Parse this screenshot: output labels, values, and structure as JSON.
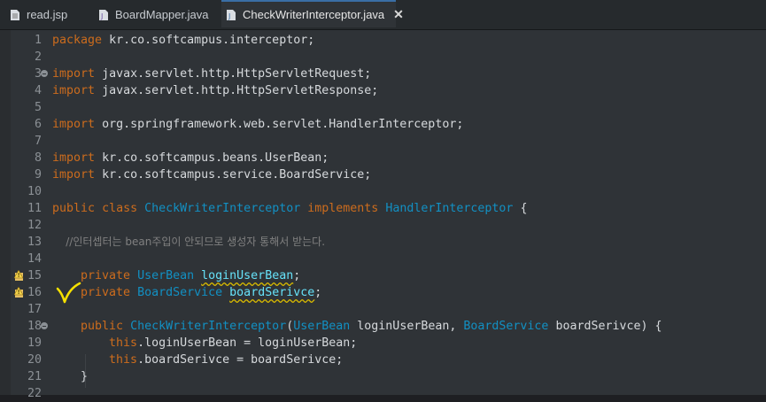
{
  "tabs": [
    {
      "label": "read.jsp",
      "active": false
    },
    {
      "label": "BoardMapper.java",
      "active": false
    },
    {
      "label": "CheckWriterInterceptor.java",
      "active": true
    }
  ],
  "colors": {
    "keyword": "#cc6c1d",
    "type": "#1290c3",
    "field": "#66e1f8",
    "comment": "#808080",
    "annotation_mark": "#f5e000"
  },
  "editor": {
    "lines": [
      {
        "n": "1",
        "segs": [
          [
            "kw",
            "package"
          ],
          [
            "",
            "kr.co.softcampus.interceptor;"
          ]
        ]
      },
      {
        "n": "2",
        "segs": []
      },
      {
        "n": "3",
        "fold": true,
        "segs": [
          [
            "kw",
            "import"
          ],
          [
            "",
            "javax.servlet.http.HttpServletRequest;"
          ]
        ]
      },
      {
        "n": "4",
        "segs": [
          [
            "kw",
            "import"
          ],
          [
            "",
            "javax.servlet.http.HttpServletResponse;"
          ]
        ]
      },
      {
        "n": "5",
        "segs": []
      },
      {
        "n": "6",
        "segs": [
          [
            "kw",
            "import"
          ],
          [
            "",
            "org.springframework.web.servlet.HandlerInterceptor;"
          ]
        ]
      },
      {
        "n": "7",
        "segs": []
      },
      {
        "n": "8",
        "segs": [
          [
            "kw",
            "import"
          ],
          [
            "",
            "kr.co.softcampus.beans.UserBean;"
          ]
        ]
      },
      {
        "n": "9",
        "segs": [
          [
            "kw",
            "import"
          ],
          [
            "",
            "kr.co.softcampus.service.BoardService;"
          ]
        ]
      },
      {
        "n": "10",
        "segs": []
      },
      {
        "n": "11",
        "segs": [
          [
            "kw",
            "public"
          ],
          [
            "kw",
            "class"
          ],
          [
            "ty",
            "CheckWriterInterceptor"
          ],
          [
            "kw",
            "implements"
          ],
          [
            "ty",
            "HandlerInterceptor"
          ],
          [
            "",
            "{"
          ]
        ]
      },
      {
        "n": "12",
        "segs": []
      },
      {
        "n": "13",
        "segs": [
          [
            "cm",
            "    //인터셉터는 bean주입이 안되므로 생성자 통해서 받는다."
          ]
        ]
      },
      {
        "n": "14",
        "segs": []
      },
      {
        "n": "15",
        "warn": true,
        "segs": [
          [
            "kw",
            "    private"
          ],
          [
            "ty",
            "UserBean"
          ],
          [
            "fld squig",
            "loginUserBean"
          ],
          [
            "",
            ";"
          ]
        ]
      },
      {
        "n": "16",
        "warn": true,
        "segs": [
          [
            "kw",
            "    private"
          ],
          [
            "ty",
            "BoardService"
          ],
          [
            "fld squig",
            "boardSerivce"
          ],
          [
            "",
            ";"
          ]
        ]
      },
      {
        "n": "17",
        "segs": []
      },
      {
        "n": "18",
        "fold": true,
        "segs": [
          [
            "kw",
            "    public"
          ],
          [
            "ty",
            "CheckWriterInterceptor"
          ],
          [
            "",
            "("
          ],
          [
            "ty",
            "UserBean"
          ],
          [
            "",
            "loginUserBean,"
          ],
          [
            "ty",
            "BoardService"
          ],
          [
            "",
            "boardSerivce) {"
          ]
        ]
      },
      {
        "n": "19",
        "segs": [
          [
            "kw",
            "        this"
          ],
          [
            "",
            ".loginUserBean = loginUserBean;"
          ]
        ]
      },
      {
        "n": "20",
        "segs": [
          [
            "kw",
            "        this"
          ],
          [
            "",
            ".boardSerivce = boardSerivce;"
          ]
        ]
      },
      {
        "n": "21",
        "segs": [
          [
            "",
            "    }"
          ]
        ]
      },
      {
        "n": "22",
        "segs": []
      }
    ]
  }
}
